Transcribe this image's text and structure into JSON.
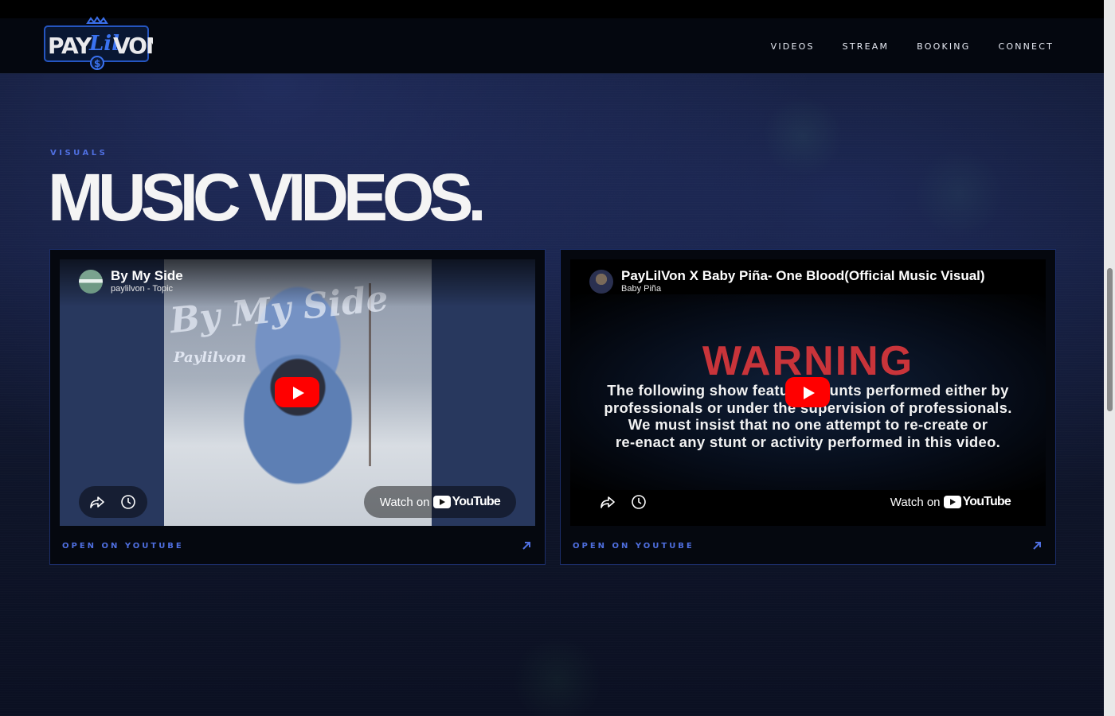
{
  "site": {
    "logo_text": "PAY LIL VON"
  },
  "nav": {
    "items": [
      {
        "label": "VIDEOS"
      },
      {
        "label": "STREAM"
      },
      {
        "label": "BOOKING"
      },
      {
        "label": "CONNECT"
      }
    ]
  },
  "section": {
    "eyebrow": "VISUALS",
    "title": "MUSIC VIDEOS."
  },
  "videos": [
    {
      "title": "By My Side",
      "channel": "paylilvon - Topic",
      "thumb_title": "By My Side",
      "thumb_subtitle": "Paylilvon",
      "watch_label": "Watch on",
      "yt_word": "YouTube",
      "open_label": "OPEN ON YOUTUBE"
    },
    {
      "title": "PayLilVon X Baby Piña- One Blood(Official Music Visual)",
      "channel": "Baby Piña",
      "warning_title": "WARNING",
      "warning_lines": [
        "The following show features stunts performed either by",
        "professionals or under the supervision of professionals.",
        "We must insist that no one attempt to re-create or",
        "re-enact any stunt or activity performed in this video."
      ],
      "watch_label": "Watch on",
      "yt_word": "YouTube",
      "open_label": "OPEN ON YOUTUBE"
    }
  ],
  "colors": {
    "accent": "#4f6fe0",
    "youtube_red": "#ff0000",
    "warning_red": "#c9343a"
  }
}
